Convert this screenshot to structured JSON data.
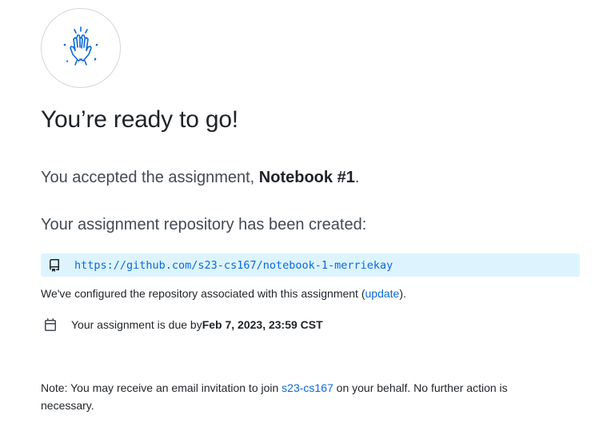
{
  "icons": {
    "celebration": "high-five-icon",
    "repo": "repo-icon",
    "calendar": "calendar-icon"
  },
  "heading": "You’re ready to go!",
  "accepted": {
    "prefix": "You accepted the assignment, ",
    "assignment_name": "Notebook #1",
    "suffix": "."
  },
  "repo_heading": "Your assignment repository has been created:",
  "repo_url": "https://github.com/s23-cs167/notebook-1-merriekay",
  "configured": {
    "prefix": "We've configured the repository associated with this assignment (",
    "link": "update",
    "suffix": ")."
  },
  "due": {
    "prefix": "Your assignment is due by ",
    "datetime": "Feb 7, 2023, 23:59 CST"
  },
  "note": {
    "prefix": "Note: You may receive an email invitation to join ",
    "org_link": "s23-cs167",
    "suffix": " on your behalf. No further action is necessary."
  },
  "colors": {
    "link": "#0969da",
    "repo_bg": "#ddf4ff",
    "text": "#1f2328"
  }
}
